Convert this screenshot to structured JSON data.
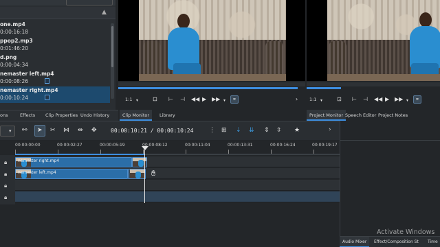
{
  "bin": {
    "items": [
      {
        "name": "one.mp4",
        "duration": "0:00:16:18",
        "flag": false,
        "selected": false
      },
      {
        "name": "ppop2.mp3",
        "duration": "0:01:46:20",
        "flag": false,
        "selected": false
      },
      {
        "name": "d.png",
        "duration": "0:00:04:34",
        "flag": false,
        "selected": false
      },
      {
        "name": "nemaster left.mp4",
        "duration": "0:00:08:26",
        "flag": true,
        "selected": false
      },
      {
        "name": "nemaster right.mp4",
        "duration": "0:00:10:24",
        "flag": true,
        "selected": true
      }
    ]
  },
  "left_tabs": [
    "ons",
    "Effects",
    "Clip Properties",
    "Undo History"
  ],
  "clip_monitor": {
    "zoom": "1:1",
    "tabs": [
      "Clip Monitor",
      "Library"
    ],
    "progress": 0.96
  },
  "project_monitor": {
    "zoom": "1:1",
    "tabs": [
      "Project Monitor",
      "Speech Editor",
      "Project Notes"
    ],
    "progress": 0.26
  },
  "timeline": {
    "timecode": "00:00:10:21 / 00:00:10:24",
    "ruler_labels": [
      "00:00:00:00",
      "00:00:02:27",
      "00:00:05:19",
      "00:00:08:12",
      "00:00:11:04",
      "00:00:13:31",
      "00:00:16:24",
      "00:00:19:17"
    ],
    "clips": [
      {
        "label": "nemaster right.mp4",
        "track": 0
      },
      {
        "label": "nemaster left.mp4",
        "track": 1
      }
    ]
  },
  "right_tabs": [
    "Audio Mixer",
    "Effect/Composition St",
    "Time"
  ],
  "watermark": "Activate Windows",
  "colors": {
    "accent": "#3d8ee0",
    "clip": "#2b6ea8",
    "selected_row": "#1d4a6e"
  }
}
